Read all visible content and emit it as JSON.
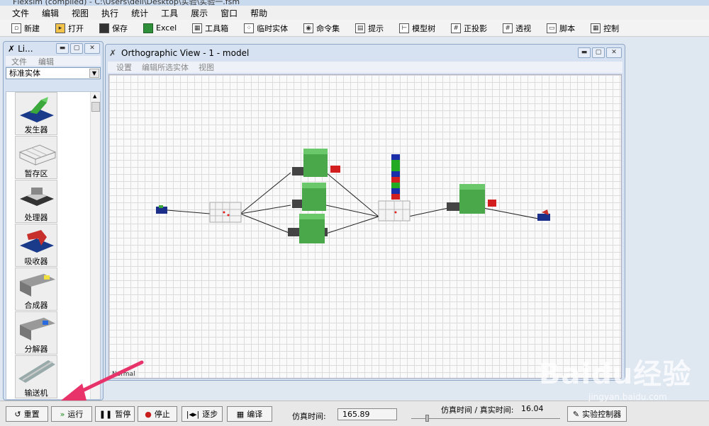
{
  "app_title": "Flexsim (compiled) - C:\\Users\\dell\\Desktop\\实验\\实验一.fsm",
  "menu": [
    "文件",
    "编辑",
    "视图",
    "执行",
    "统计",
    "工具",
    "展示",
    "窗口",
    "帮助"
  ],
  "toolbar": [
    {
      "label": "新建",
      "icon": "new-file-icon"
    },
    {
      "label": "打开",
      "icon": "open-folder-icon"
    },
    {
      "label": "保存",
      "icon": "save-disk-icon"
    },
    {
      "label": "Excel",
      "icon": "excel-icon"
    },
    {
      "label": "工具箱",
      "icon": "toolbox-icon"
    },
    {
      "label": "临时实体",
      "icon": "flowitem-icon"
    },
    {
      "label": "命令集",
      "icon": "command-set-icon"
    },
    {
      "label": "提示",
      "icon": "hint-icon"
    },
    {
      "label": "模型树",
      "icon": "model-tree-icon"
    },
    {
      "label": "正投影",
      "icon": "ortho-grid-icon"
    },
    {
      "label": "透视",
      "icon": "perspective-grid-icon"
    },
    {
      "label": "脚本",
      "icon": "script-icon"
    },
    {
      "label": "控制",
      "icon": "control-icon"
    }
  ],
  "library": {
    "title": "Li...",
    "menu": [
      "文件",
      "编辑"
    ],
    "category": "标准实体",
    "items": [
      {
        "label": "发生器",
        "icon": "source-icon"
      },
      {
        "label": "暂存区",
        "icon": "queue-icon"
      },
      {
        "label": "处理器",
        "icon": "processor-icon"
      },
      {
        "label": "吸收器",
        "icon": "sink-icon"
      },
      {
        "label": "合成器",
        "icon": "combiner-icon"
      },
      {
        "label": "分解器",
        "icon": "separator-icon"
      },
      {
        "label": "输送机",
        "icon": "conveyor-icon"
      }
    ]
  },
  "view": {
    "title": "Orthographic View - 1 - model",
    "menu": [
      "设置",
      "编辑所选实体",
      "视图"
    ],
    "status": "Normal"
  },
  "controls": {
    "buttons": [
      {
        "label": "重置",
        "icon": "reset-icon"
      },
      {
        "label": "运行",
        "icon": "run-icon"
      },
      {
        "label": "暂停",
        "icon": "pause-icon"
      },
      {
        "label": "停止",
        "icon": "stop-icon"
      },
      {
        "label": "逐步",
        "icon": "step-icon"
      },
      {
        "label": "编译",
        "icon": "compile-icon"
      }
    ],
    "sim_time_label": "仿真时间:",
    "sim_time_value": "165.89",
    "ratio_label": "仿真时间 / 真实时间:",
    "ratio_value": "16.04",
    "experiment_label": "实验控制器"
  },
  "colors": {
    "processor_green": "#4aa84a",
    "queue_blue": "#1a2e8a",
    "highlight_arrow": "#e8336a"
  },
  "watermark": {
    "text1": "Baidu经验",
    "text2": "jingyan.baidu.com"
  }
}
